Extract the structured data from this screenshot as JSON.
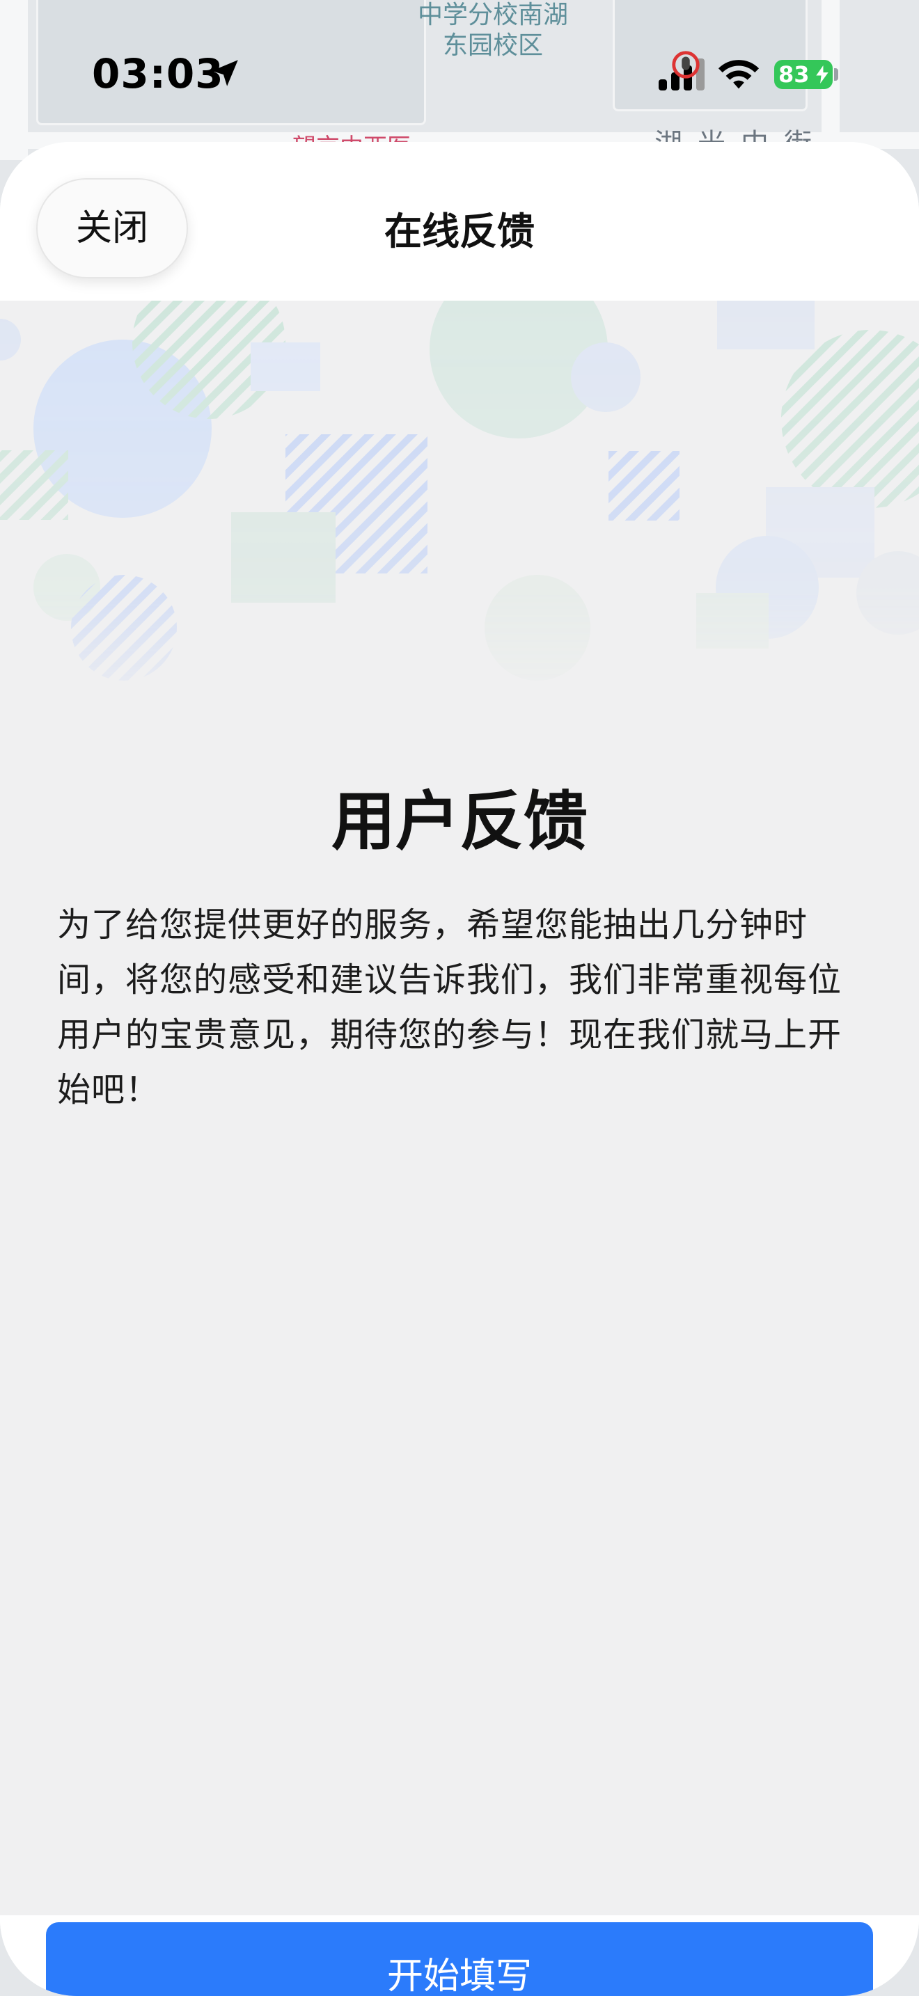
{
  "status_bar": {
    "time": "03:03",
    "battery": "83",
    "icons": [
      "location-arrow-icon",
      "signal-icon",
      "wifi-icon",
      "battery-icon"
    ]
  },
  "map": {
    "poi_label_line1": "中学分校南湖",
    "poi_label_line2": "东园校区",
    "red_label": "望京中西医",
    "street_label": "湖光中街"
  },
  "sheet": {
    "close_label": "关闭",
    "title": "在线反馈"
  },
  "content": {
    "heading": "用户反馈",
    "intro": "为了给您提供更好的服务，希望您能抽出几分钟时间，将您的感受和建议告诉我们，我们非常重视每位用户的宝贵意见，期待您的参与！现在我们就马上开始吧！",
    "start_button": "开始填写"
  },
  "colors": {
    "primary": "#2b7bfb",
    "battery": "#34c759",
    "content_bg": "#f0f0f1"
  }
}
